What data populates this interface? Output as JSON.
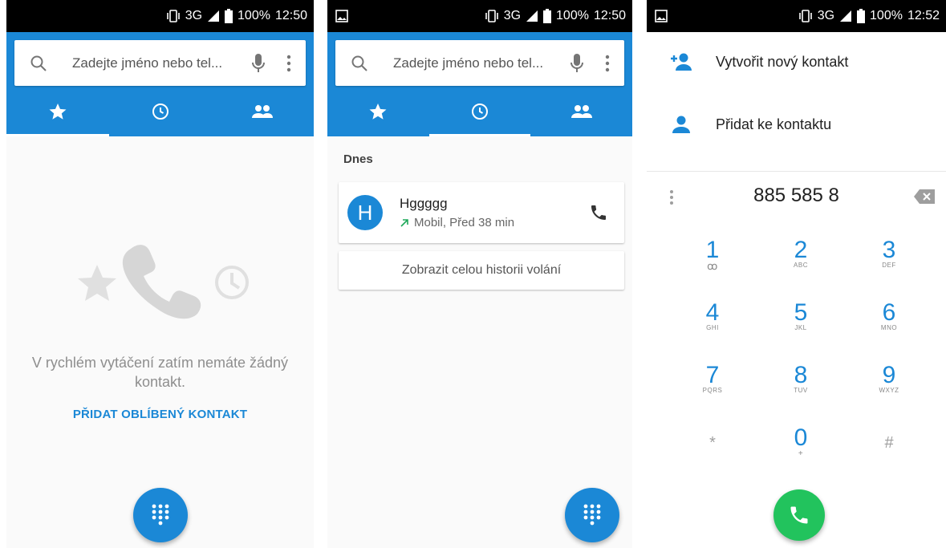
{
  "screens": [
    {
      "status": {
        "signal": "3G",
        "battery": "100%",
        "time": "12:50"
      },
      "search": {
        "placeholder": "Zadejte jméno nebo tel..."
      },
      "empty": {
        "message": "V rychlém vytáčení zatím nemáte žádný kontakt.",
        "action": "PŘIDAT OBLÍBENÝ KONTAKT"
      }
    },
    {
      "status": {
        "signal": "3G",
        "battery": "100%",
        "time": "12:50"
      },
      "search": {
        "placeholder": "Zadejte jméno nebo tel..."
      },
      "recents": {
        "section": "Dnes",
        "calls": [
          {
            "initial": "H",
            "name": "Hggggg",
            "detail": "Mobil, Před 38 min"
          }
        ],
        "history_button": "Zobrazit celou historii volání"
      }
    },
    {
      "status": {
        "signal": "3G",
        "battery": "100%",
        "time": "12:52"
      },
      "actions": {
        "create_contact": "Vytvořit nový kontakt",
        "add_to_contact": "Přidat ke kontaktu"
      },
      "dialer": {
        "number": "885 585 8",
        "keys": [
          {
            "digit": "1",
            "letters": "ꝏ"
          },
          {
            "digit": "2",
            "letters": "ABC"
          },
          {
            "digit": "3",
            "letters": "DEF"
          },
          {
            "digit": "4",
            "letters": "GHI"
          },
          {
            "digit": "5",
            "letters": "JKL"
          },
          {
            "digit": "6",
            "letters": "MNO"
          },
          {
            "digit": "7",
            "letters": "PQRS"
          },
          {
            "digit": "8",
            "letters": "TUV"
          },
          {
            "digit": "9",
            "letters": "WXYZ"
          },
          {
            "digit": "*",
            "letters": ""
          },
          {
            "digit": "0",
            "letters": "+"
          },
          {
            "digit": "#",
            "letters": ""
          }
        ]
      }
    }
  ],
  "colors": {
    "primary": "#1b88d6",
    "call_green": "#22c35d",
    "outgoing_arrow": "#1fa85a"
  }
}
